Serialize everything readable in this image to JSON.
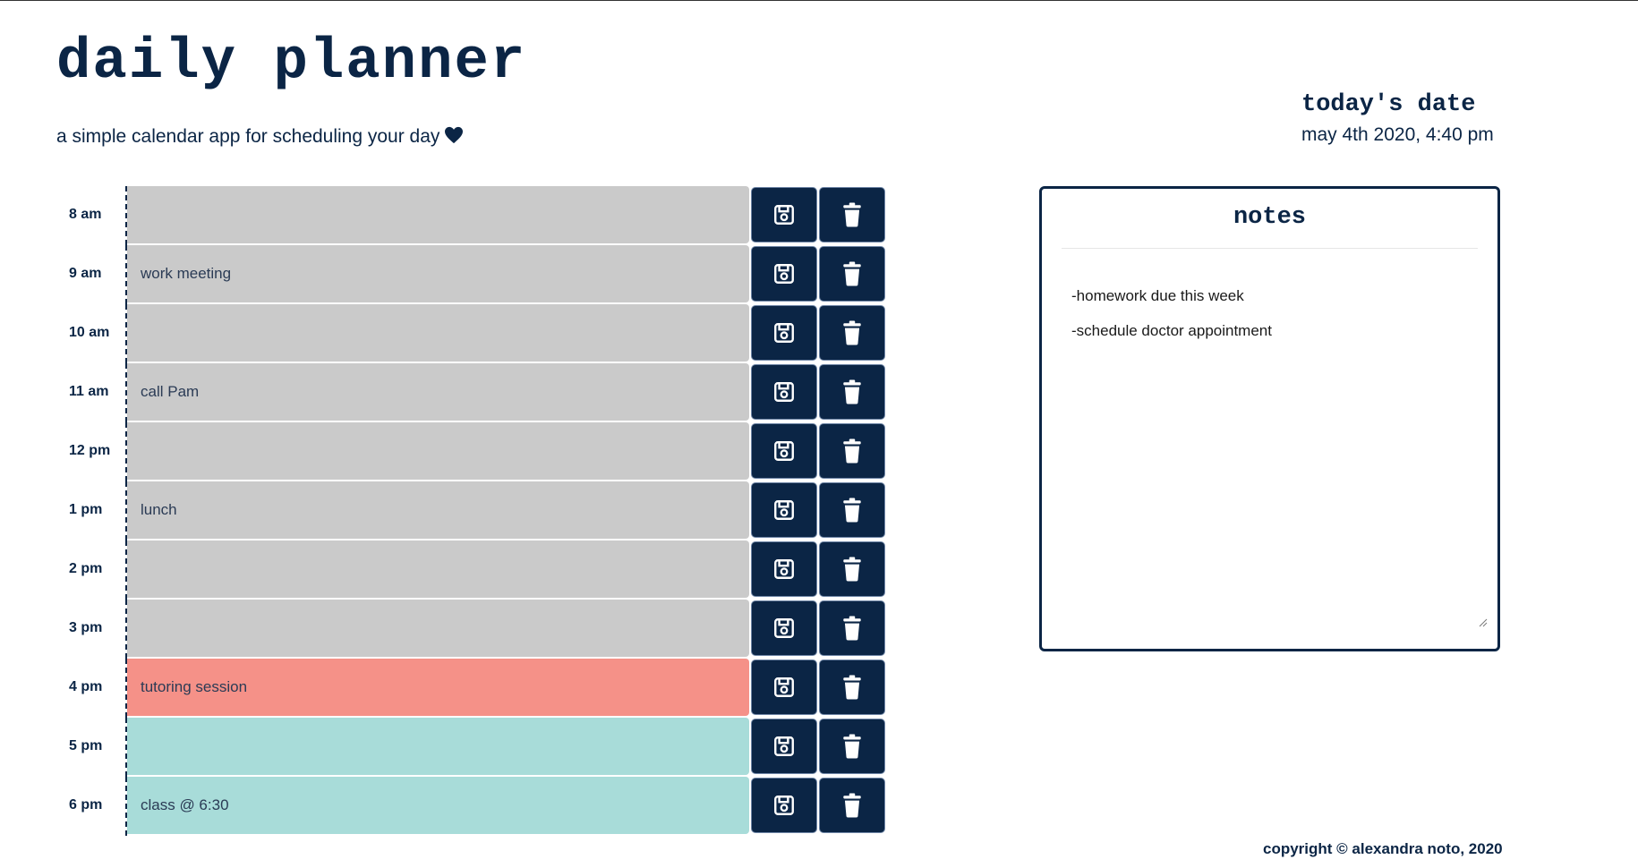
{
  "header": {
    "title": "daily planner",
    "subtitle": "a simple calendar app for scheduling your day"
  },
  "date": {
    "label": "today's date",
    "value": "may 4th 2020, 4:40 pm"
  },
  "planner": {
    "rows": [
      {
        "hour": "8 am",
        "text": "",
        "status": "past"
      },
      {
        "hour": "9 am",
        "text": "work meeting",
        "status": "past"
      },
      {
        "hour": "10 am",
        "text": "",
        "status": "past"
      },
      {
        "hour": "11 am",
        "text": "call Pam",
        "status": "past"
      },
      {
        "hour": "12 pm",
        "text": "",
        "status": "past"
      },
      {
        "hour": "1 pm",
        "text": "lunch",
        "status": "past"
      },
      {
        "hour": "2 pm",
        "text": "",
        "status": "past"
      },
      {
        "hour": "3 pm",
        "text": "",
        "status": "past"
      },
      {
        "hour": "4 pm",
        "text": "tutoring session",
        "status": "present"
      },
      {
        "hour": "5 pm",
        "text": "",
        "status": "future"
      },
      {
        "hour": "6 pm",
        "text": "class @ 6:30",
        "status": "future"
      }
    ],
    "save_icon": "save-icon",
    "delete_icon": "trash-icon"
  },
  "notes": {
    "title": "notes",
    "lines": [
      "-homework due this week",
      "-schedule doctor appointment"
    ]
  },
  "footer": {
    "copyright": "copyright © alexandra noto, 2020"
  },
  "colors": {
    "navy": "#0b2545",
    "past": "#cacaca",
    "present": "#f59188",
    "future": "#a8dcd9"
  }
}
